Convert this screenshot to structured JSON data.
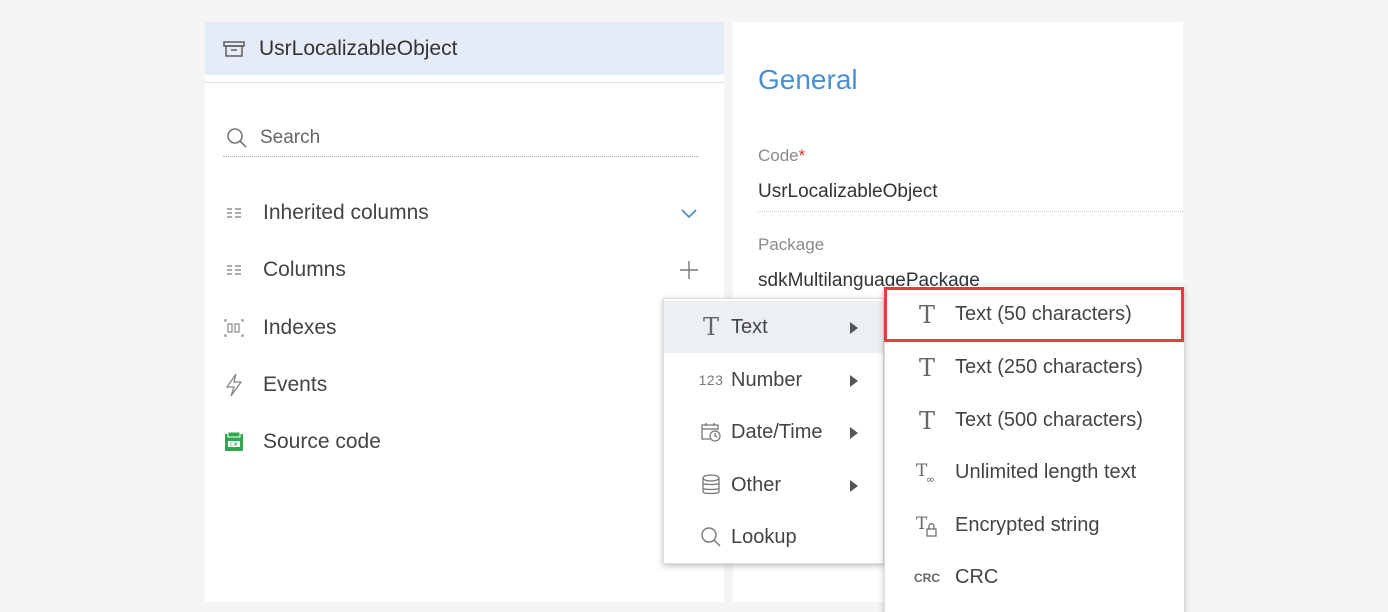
{
  "object": {
    "title": "UsrLocalizableObject"
  },
  "search": {
    "placeholder": "Search"
  },
  "nav": {
    "items": [
      {
        "label": "Inherited columns"
      },
      {
        "label": "Columns"
      },
      {
        "label": "Indexes"
      },
      {
        "label": "Events"
      },
      {
        "label": "Source code"
      }
    ]
  },
  "general": {
    "title": "General",
    "code_label": "Code",
    "code_required": "*",
    "code_value": "UsrLocalizableObject",
    "package_label": "Package",
    "package_value": "sdkMultilanguagePackage"
  },
  "menu": {
    "items": [
      {
        "label": "Text",
        "icon": "text-type-icon"
      },
      {
        "label": "Number",
        "icon": "number-type-icon",
        "icon_text": "123"
      },
      {
        "label": "Date/Time",
        "icon": "calendar-clock-icon"
      },
      {
        "label": "Other",
        "icon": "database-icon"
      },
      {
        "label": "Lookup",
        "icon": "search-icon"
      }
    ]
  },
  "submenu": {
    "items": [
      {
        "label": "Text (50 characters)",
        "icon": "text-type-icon"
      },
      {
        "label": "Text (250 characters)",
        "icon": "text-type-icon"
      },
      {
        "label": "Text (500 characters)",
        "icon": "text-type-icon"
      },
      {
        "label": "Unlimited length text",
        "icon": "unlimited-text-icon"
      },
      {
        "label": "Encrypted string",
        "icon": "encrypted-text-icon"
      },
      {
        "label": "CRC",
        "icon": "crc-icon",
        "icon_text": "CRC"
      }
    ]
  },
  "colors": {
    "accent": "#4b8fcf",
    "highlight": "#e53d3d",
    "header_bg": "#e6ecf7",
    "source_code_icon": "#2fa84f"
  }
}
